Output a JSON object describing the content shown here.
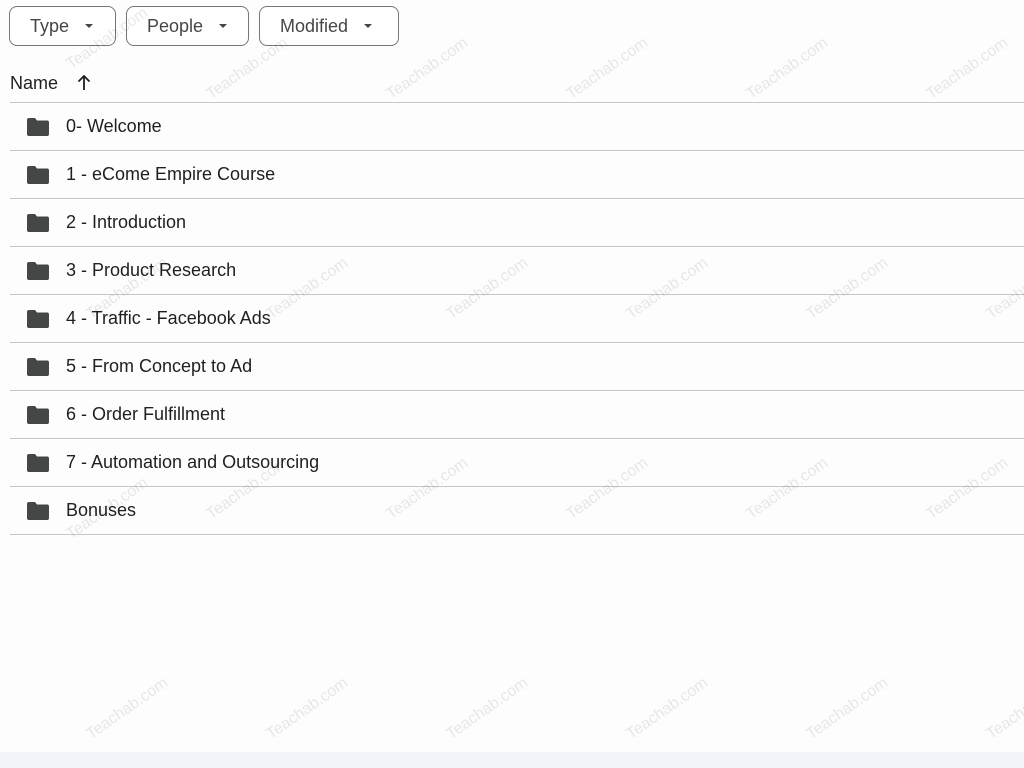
{
  "filters": [
    {
      "label": "Type"
    },
    {
      "label": "People"
    },
    {
      "label": "Modified"
    }
  ],
  "header": {
    "name_label": "Name",
    "sort_icon": "arrow-up-icon"
  },
  "rows": [
    {
      "label": "0- Welcome",
      "icon": "folder-icon"
    },
    {
      "label": "1 - eCome Empire Course",
      "icon": "folder-icon"
    },
    {
      "label": "2 - Introduction",
      "icon": "folder-icon"
    },
    {
      "label": "3 - Product Research",
      "icon": "folder-icon"
    },
    {
      "label": "4 - Traffic - Facebook Ads",
      "icon": "folder-icon"
    },
    {
      "label": "5 - From Concept to Ad",
      "icon": "folder-icon"
    },
    {
      "label": "6 - Order Fulfillment",
      "icon": "folder-icon"
    },
    {
      "label": "7 - Automation and Outsourcing",
      "icon": "folder-icon"
    },
    {
      "label": "Bonuses",
      "icon": "folder-icon"
    }
  ],
  "watermark": {
    "text": "Teachab.com"
  },
  "colors": {
    "text": "#1f1f1f",
    "icon": "#444746",
    "divider": "#c7c7c7",
    "background": "#fdfdfd"
  }
}
